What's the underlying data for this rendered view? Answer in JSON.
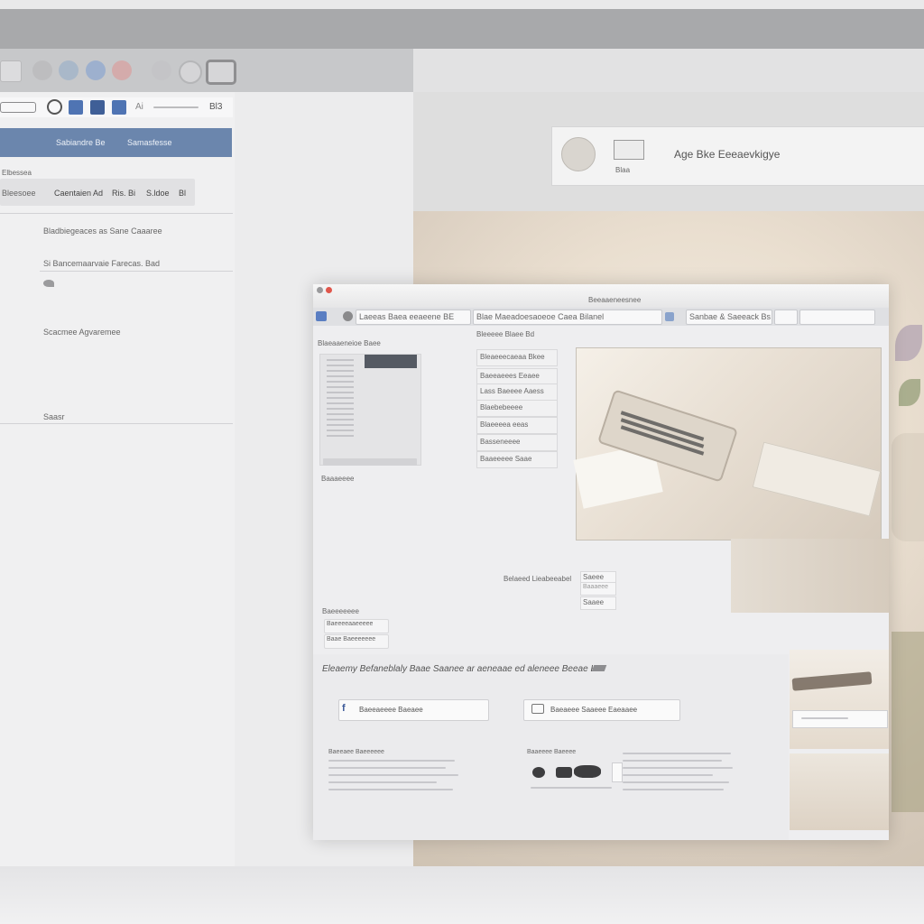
{
  "left_window": {
    "panel_strip_title": "Ai",
    "panel_strip_badge": "Bl3",
    "header_tabs": [
      "Sabiandre Be",
      "Samasfesse"
    ],
    "breadcrumb": "Elbessea",
    "tab_row": [
      {
        "label": "Caentaien Ad"
      },
      {
        "label": "Ris. Bi"
      },
      {
        "label": "S.ldoe"
      },
      {
        "label": "Bl"
      }
    ],
    "items": [
      "Bladbiegeaces as Sane Caaaree",
      "Si Bancemaarvaie Farecas. Bad",
      "Scacmee Agvaremee",
      "Saasr"
    ]
  },
  "profile_card": {
    "name": "Age Bke Eeeaevkigye",
    "sub": "Blaa"
  },
  "browser": {
    "window_title": "Beeaaeneesnee",
    "address_segments": [
      "Laeeas Baea eeaeene  BE",
      "Blae  Maeadoesaoeoe  Caea  Bilanel",
      "Sanbae & Saeeack Bs"
    ],
    "sidebar_title": "Blaeaaeneioe Baee",
    "sidebar_caption": "Baaaeeee",
    "menu_heading": "Bleeeee Blaee Bd",
    "menu_items": [
      "Bleaeeecaeaa Bkee",
      "Baeeaeees Eeaee",
      "Lass Baeeee Aaess",
      "Blaebebeeee",
      "Blaeeeea eeas",
      "Basseneeee",
      "Baaeeeee  Saae"
    ],
    "photo_caption": "Belaeed Lieabeeabel",
    "small_fields": [
      "Saeee",
      "Baaaeee",
      "Saaee"
    ],
    "ext_heading": "Baeeeeeee",
    "ext_fields": [
      "Baeeeeaaeeeee",
      "Baae Baeeeeeee"
    ],
    "promo_title": "Eleaemy Befaneblaly Baae Saanee ar aeneaae ed aleneee Beeae Beeaneee",
    "buttons": [
      {
        "label": "Baeeaeeee Baeaee",
        "icon": "facebook-icon"
      },
      {
        "label": "Baeaeee Saaeee Eaeaaee",
        "icon": "window-icon"
      }
    ],
    "footer_heading_1": "Baeeaee Baeeeeee",
    "footer_heading_2": "Baaeeee Baeeee"
  },
  "colors": {
    "accent_blue": "#6b86ad",
    "traffic_red": "#e0564b",
    "traffic_yellow": "#f0b640"
  }
}
